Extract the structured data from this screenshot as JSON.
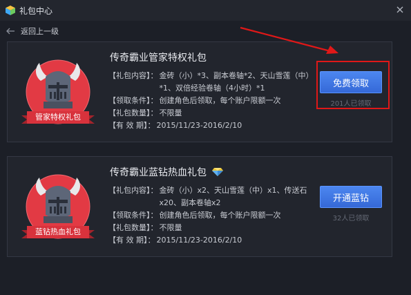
{
  "window": {
    "title": "礼包中心"
  },
  "nav": {
    "back_label": "返回上一级"
  },
  "gifts": [
    {
      "title": "传奇霸业管家特权礼包",
      "badge_label": "管家特权礼包",
      "rows": [
        {
          "key": "【礼包内容】：",
          "value": "金砖（小）*3、副本卷轴*2、天山雪莲（中）*1、双倍经验卷轴（4小时）*1"
        },
        {
          "key": "【领取条件】：",
          "value": "创建角色后领取，每个账户限额一次"
        },
        {
          "key": "【礼包数量】：",
          "value": "不限量"
        },
        {
          "key": "【有 效 期】：",
          "value": "2015/11/23-2016/2/10"
        }
      ],
      "button_label": "免费领取",
      "claimed_text": "201人已领取"
    },
    {
      "title": "传奇霸业蓝钻热血礼包",
      "badge_label": "蓝钻热血礼包",
      "rows": [
        {
          "key": "【礼包内容】：",
          "value": "金砖（小）x2、天山雪莲（中）x1、传送石x20、副本卷轴x2"
        },
        {
          "key": "【领取条件】：",
          "value": "创建角色后领取，每个账户限额一次"
        },
        {
          "key": "【礼包数量】：",
          "value": "不限量"
        },
        {
          "key": "【有 效 期】：",
          "value": "2015/11/23-2016/2/10"
        }
      ],
      "button_label": "开通蓝钻",
      "claimed_text": "32人已领取"
    }
  ],
  "colors": {
    "accent_button": "#3f7be6",
    "highlight": "#e01818",
    "badge_red": "#e23a44"
  },
  "icons": [
    "cube-icon",
    "close-icon",
    "back-arrow-icon",
    "knight-helmet-icon",
    "diamond-icon"
  ]
}
